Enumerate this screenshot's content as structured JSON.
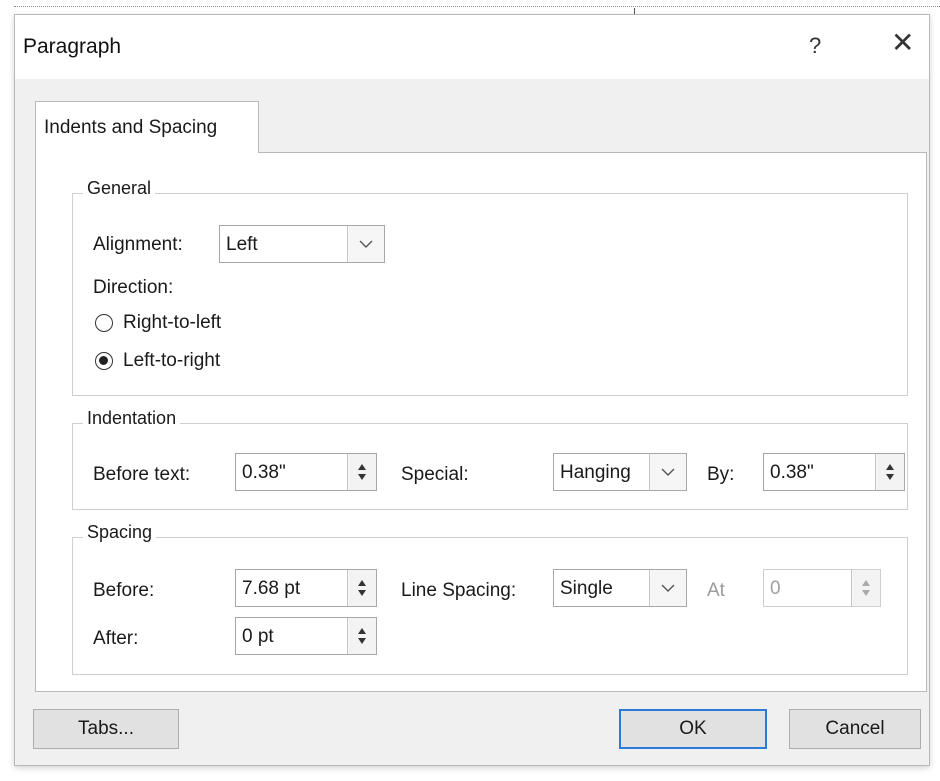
{
  "window": {
    "title": "Paragraph",
    "help": "?",
    "close": "✕"
  },
  "tabs": [
    {
      "label": "Indents and Spacing"
    }
  ],
  "general": {
    "title": "General",
    "alignment_label": "Alignment:",
    "alignment_value": "Left",
    "direction_label": "Direction:",
    "radios": [
      {
        "label": "Right-to-left",
        "checked": false
      },
      {
        "label": "Left-to-right",
        "checked": true
      }
    ]
  },
  "indentation": {
    "title": "Indentation",
    "before_text_label": "Before text:",
    "before_text_value": "0.38\"",
    "special_label": "Special:",
    "special_value": "Hanging",
    "by_label": "By:",
    "by_value": "0.38\""
  },
  "spacing": {
    "title": "Spacing",
    "before_label": "Before:",
    "before_value": "7.68 pt",
    "after_label": "After:",
    "after_value": "0 pt",
    "line_spacing_label": "Line Spacing:",
    "line_spacing_value": "Single",
    "at_label": "At",
    "at_value": "0"
  },
  "buttons": {
    "tabs": "Tabs...",
    "ok": "OK",
    "cancel": "Cancel"
  },
  "colors": {
    "dialog_bg": "#f0f0f0",
    "panel_bg": "#ffffff",
    "ok_focus_border": "#2a7ad6",
    "disabled_text": "#9a9a9a"
  }
}
